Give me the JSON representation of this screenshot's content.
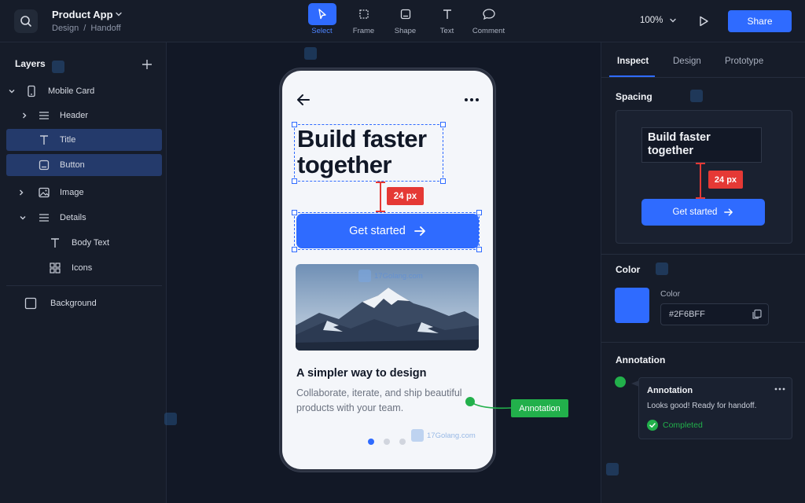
{
  "header": {
    "title": "Product App",
    "breadcrumb": [
      "Design",
      "Handoff"
    ],
    "tools": [
      {
        "label": "Select",
        "icon": "cursor-icon",
        "active": true
      },
      {
        "label": "Frame",
        "icon": "frame-icon",
        "active": false
      },
      {
        "label": "Shape",
        "icon": "shape-icon",
        "active": false
      },
      {
        "label": "Text",
        "icon": "text-icon",
        "active": false
      },
      {
        "label": "Comment",
        "icon": "comment-icon",
        "active": false
      }
    ],
    "zoom": "100%",
    "share_label": "Share"
  },
  "layers": {
    "title": "Layers",
    "items": [
      {
        "label": "Mobile Card",
        "icon": "phone-icon",
        "expanded": true,
        "selected": false
      },
      {
        "label": "Header",
        "icon": "menu-icon",
        "expanded": false,
        "selected": false
      },
      {
        "label": "Title",
        "icon": "text-icon",
        "selected": true
      },
      {
        "label": "Button",
        "icon": "button-icon",
        "selected": true
      },
      {
        "label": "Image",
        "icon": "image-icon",
        "expanded": false,
        "selected": false
      },
      {
        "label": "Details",
        "icon": "menu-icon",
        "expanded": true,
        "selected": false
      },
      {
        "label": "Body Text",
        "icon": "text-icon",
        "selected": false
      },
      {
        "label": "Icons",
        "icon": "grid-icon",
        "selected": false
      },
      {
        "label": "Background",
        "icon": "square-icon",
        "selected": false
      }
    ]
  },
  "canvas": {
    "headline": "Build faster together",
    "spacing_tag": "24 px",
    "cta_label": "Get started",
    "card_title": "A simpler way to design",
    "card_body": "Collaborate, iterate, and ship beautiful products with your team.",
    "annotation_tag": "Annotation",
    "watermark": "17Golang.com",
    "carousel_active_index": 0
  },
  "inspect": {
    "tabs": [
      "Inspect",
      "Design",
      "Prototype"
    ],
    "active_tab": "Inspect",
    "spacing": {
      "title": "Spacing",
      "preview_title": "Build faster together",
      "tag": "24 px",
      "button_label": "Get started"
    },
    "color": {
      "title": "Color",
      "label": "Color",
      "hex": "#2F6BFF"
    },
    "annotation": {
      "title": "Annotation",
      "card_title": "Annotation",
      "card_text": "Looks good! Ready for handoff.",
      "status": "Completed"
    }
  },
  "colors": {
    "accent": "#2f6bff",
    "measure": "#e53935",
    "success": "#22b04b"
  }
}
